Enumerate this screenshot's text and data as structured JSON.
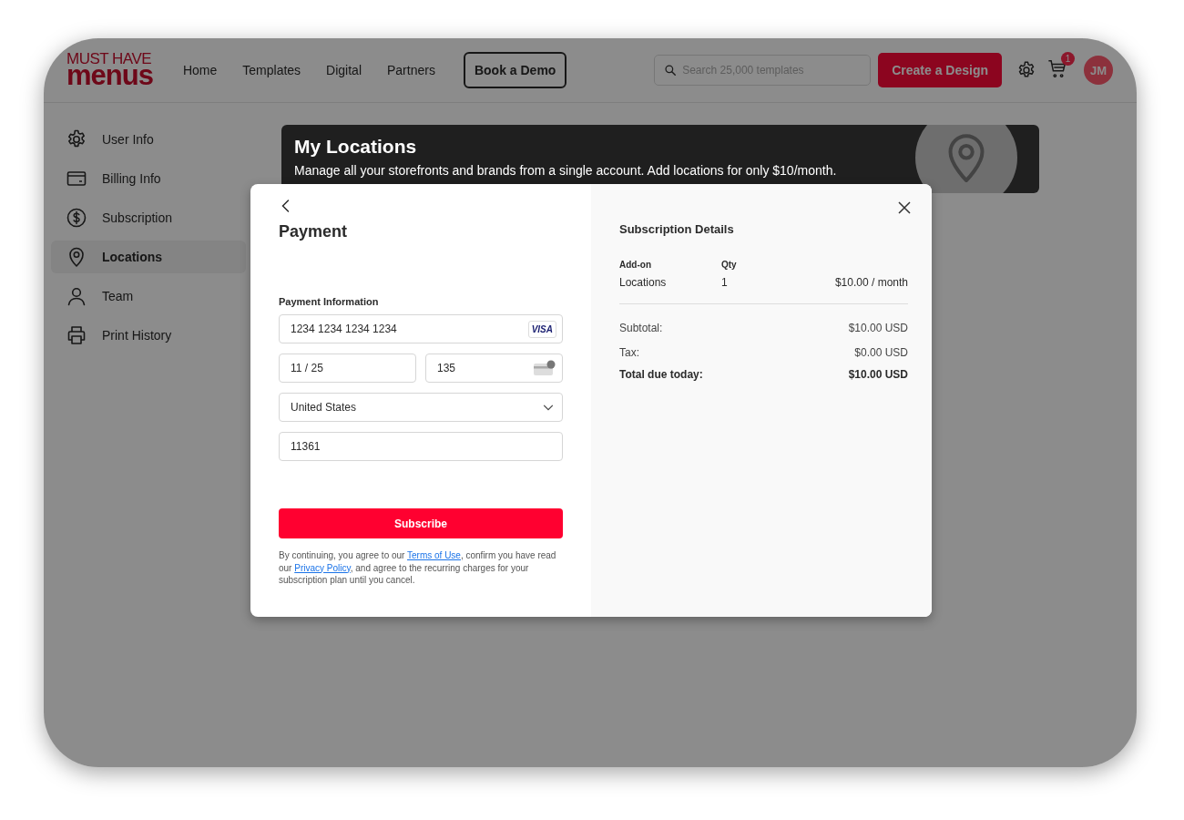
{
  "header": {
    "logo": {
      "line1": "MUST HAVE",
      "line2": "menus"
    },
    "nav": [
      {
        "label": "Home"
      },
      {
        "label": "Templates"
      },
      {
        "label": "Digital"
      },
      {
        "label": "Partners"
      }
    ],
    "demo_button": "Book a Demo",
    "search": {
      "placeholder": "Search 25,000 templates"
    },
    "create_button": "Create a Design",
    "cart_badge": "1",
    "avatar": "JM"
  },
  "sidebar": {
    "items": [
      {
        "label": "User Info",
        "selected": false
      },
      {
        "label": "Billing Info",
        "selected": false
      },
      {
        "label": "Subscription",
        "selected": false
      },
      {
        "label": "Locations",
        "selected": true
      },
      {
        "label": "Team",
        "selected": false
      },
      {
        "label": "Print History",
        "selected": false
      }
    ]
  },
  "banner": {
    "title": "My Locations",
    "text": "Manage all your storefronts and brands from a single account. Add locations for only $10/month."
  },
  "modal": {
    "title": "Payment",
    "section_label": "Payment Information",
    "card_number": "1234 1234 1234 1234",
    "card_brand": "VISA",
    "expiry": "11 / 25",
    "cvc": "135",
    "country": "United States",
    "zip": "11361",
    "subscribe_button": "Subscribe",
    "legal": [
      {
        "kind": "text",
        "text": "By continuing, you agree to our "
      },
      {
        "kind": "link",
        "text": "Terms of Use"
      },
      {
        "kind": "text",
        "text": ", confirm you have read our "
      },
      {
        "kind": "link",
        "text": "Privacy Policy"
      },
      {
        "kind": "text",
        "text": ", and agree to the recurring charges for your subscription plan until you cancel."
      }
    ],
    "details": {
      "title": "Subscription Details",
      "columns": [
        "Add-on",
        "Qty"
      ],
      "rows": [
        {
          "name": "Locations",
          "qty": "1",
          "price": "$10.00 / month"
        }
      ],
      "summary": [
        {
          "label": "Subtotal:",
          "value": "$10.00 USD",
          "kind": "normal"
        },
        {
          "label": "Tax:",
          "value": "$0.00 USD",
          "kind": "normal"
        },
        {
          "label": "Total due today:",
          "value": "$10.00 USD",
          "kind": "total"
        }
      ]
    }
  }
}
